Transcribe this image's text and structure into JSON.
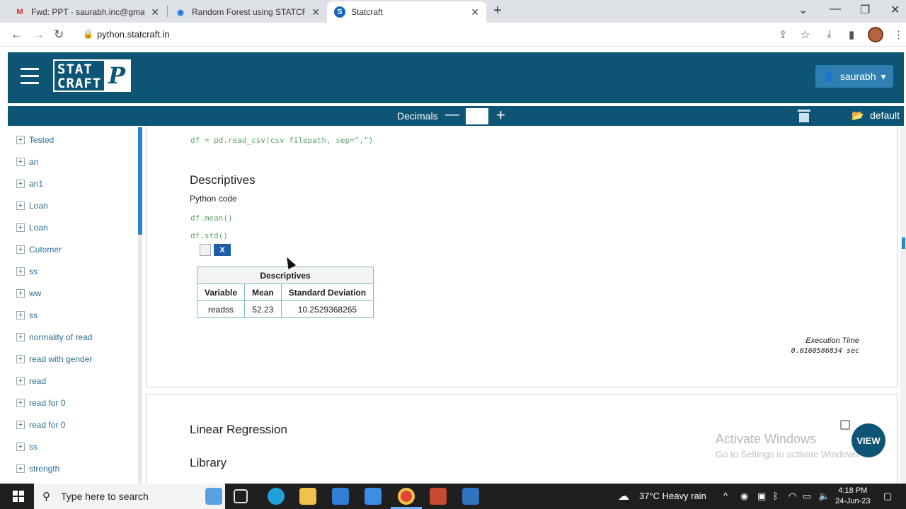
{
  "browser": {
    "tabs": [
      {
        "title": "Fwd: PPT - saurabh.inc@gmail.co",
        "favicon": "gmail-icon",
        "active": false
      },
      {
        "title": "Random Forest using STATCRAFT",
        "favicon": "statcraft-blue-icon",
        "active": false
      },
      {
        "title": "Statcraft",
        "favicon": "statcraft-s-icon",
        "active": true
      }
    ],
    "url": "python.statcraft.in"
  },
  "app": {
    "logo_top": "STAT",
    "logo_bottom": "CRAFT",
    "logo_p": "P",
    "user": "saurabh",
    "decimals_label": "Decimals",
    "decimals_value": "",
    "default_label": "default"
  },
  "sidebar": {
    "items": [
      {
        "label": "Tested"
      },
      {
        "label": "an"
      },
      {
        "label": "an1"
      },
      {
        "label": "Loan"
      },
      {
        "label": "Loan"
      },
      {
        "label": "Cutomer"
      },
      {
        "label": "ss"
      },
      {
        "label": "ww"
      },
      {
        "label": "ss"
      },
      {
        "label": "normality of read"
      },
      {
        "label": "read with gender"
      },
      {
        "label": "read"
      },
      {
        "label": "read for 0"
      },
      {
        "label": "read for 0"
      },
      {
        "label": "ss"
      },
      {
        "label": "strength"
      }
    ]
  },
  "main": {
    "code_read_csv": "df = pd.read_csv(csv filepath, sep=\",\")",
    "section_title": "Descriptives",
    "python_code_label": "Python code",
    "code_mean": "df.mean()",
    "code_std": "df.std()",
    "table": {
      "caption": "Descriptives",
      "headers": [
        "Variable",
        "Mean",
        "Standard Deviation"
      ],
      "rows": [
        [
          "readss",
          "52.23",
          "10.2529368265"
        ]
      ]
    },
    "execution_time_label": "Execution Time",
    "execution_time_value": "0.0160586834 sec",
    "next_section_title": "Linear Regression",
    "library_label": "Library",
    "view_button": "VIEW"
  },
  "watermark": {
    "line1": "Activate Windows",
    "line2": "Go to Settings to activate Windows."
  },
  "taskbar": {
    "search_placeholder": "Type here to search",
    "weather": "37°C  Heavy rain",
    "time": "4:18 PM",
    "date": "24-Jun-23"
  }
}
